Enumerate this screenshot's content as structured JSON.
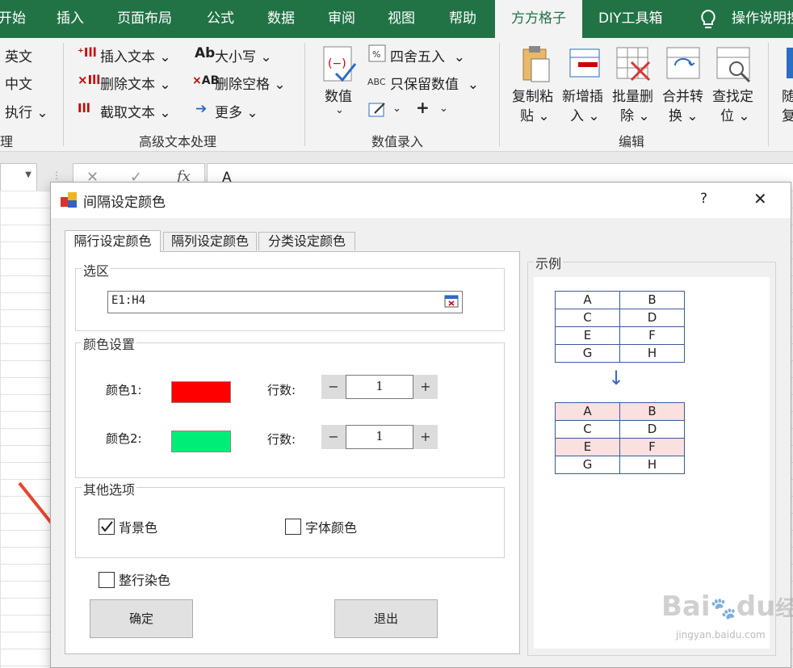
{
  "ribbon_tabs": [
    "开始",
    "插入",
    "页面布局",
    "公式",
    "数据",
    "审阅",
    "视图",
    "帮助",
    "方方格子",
    "DIY工具箱",
    "操作说明搜"
  ],
  "ribbon": {
    "left_items": [
      "英文",
      "中文",
      "执行"
    ],
    "left_group_label": "理",
    "text_group": {
      "insert_text": "插入文本",
      "delete_text": "删除文本",
      "extract_text": "截取文本",
      "case": "大小写",
      "delete_spaces": "删除空格",
      "more": "更多",
      "case_icon": "Ab",
      "spaces_icon": "AB",
      "label": "高级文本处理"
    },
    "number_group": {
      "value": "数值",
      "round": "四舍五入",
      "keep_number": "只保留数值",
      "abc": "ABC",
      "plus": "+",
      "label": "数值录入"
    },
    "edit_group": {
      "copy_paste": [
        "复制粘",
        "贴"
      ],
      "add_insert": [
        "新增插",
        "入"
      ],
      "batch_delete": [
        "批量删",
        "除"
      ],
      "merge_convert": [
        "合并转",
        "换"
      ],
      "find_locate": [
        "查找定",
        "位"
      ],
      "label": "编辑"
    },
    "cut_off": [
      "随",
      "复"
    ]
  },
  "formula_bar": {
    "cancel_icon": "✕",
    "confirm_icon": "✓",
    "fx": "fx",
    "content": "A"
  },
  "dialog": {
    "title": "间隔设定颜色",
    "help": "?",
    "close": "✕",
    "tabs": [
      "隔行设定颜色",
      "隔列设定颜色",
      "分类设定颜色"
    ],
    "selection_label": "选区",
    "selection_value": "E1:H4",
    "color_settings_label": "颜色设置",
    "color1_label": "颜色1:",
    "color2_label": "颜色2:",
    "color1": "#ff0000",
    "color2": "#00ee77",
    "rows_label": "行数:",
    "row_count_1": "1",
    "row_count_2": "1",
    "minus": "−",
    "plus": "+",
    "other_options_label": "其他选项",
    "background_color": {
      "label": "背景色",
      "checked": true
    },
    "font_color": {
      "label": "字体颜色",
      "checked": false
    },
    "whole_row": {
      "label": "整行染色",
      "checked": false
    },
    "ok": "确定",
    "exit": "退出",
    "example_label": "示例",
    "example_before": [
      [
        "A",
        "B"
      ],
      [
        "C",
        "D"
      ],
      [
        "E",
        "F"
      ],
      [
        "G",
        "H"
      ]
    ],
    "example_after": [
      [
        "A",
        "B"
      ],
      [
        "C",
        "D"
      ],
      [
        "E",
        "F"
      ],
      [
        "G",
        "H"
      ]
    ],
    "arrow": "↓"
  },
  "watermark": {
    "brand": "Bai",
    "brand2": "du",
    "cn": "经验",
    "url": "jingyan.baidu.com"
  },
  "colors": {
    "excel_green": "#217346",
    "pink": "#fbe0e0",
    "arrow_red": "#e8452c"
  }
}
